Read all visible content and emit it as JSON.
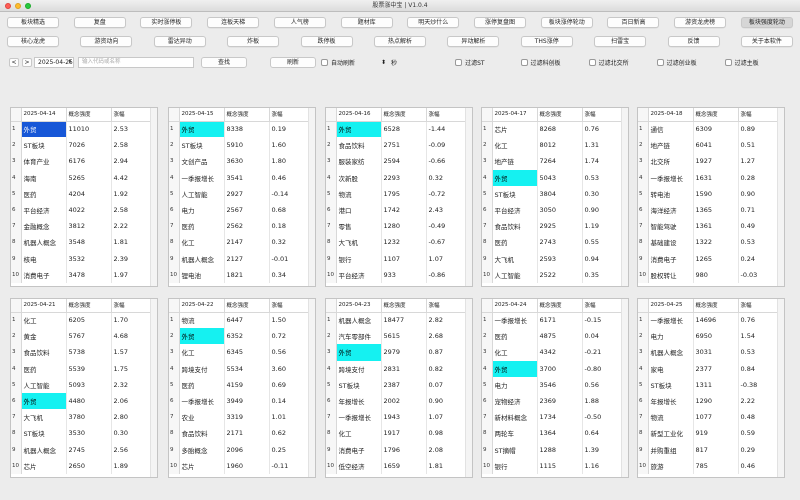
{
  "window": {
    "title": "股票涨中宝 | V1.0.4"
  },
  "toolbar_row1": [
    "板块精选",
    "复盘",
    "实时涨停板",
    "连板天梯",
    "人气榜",
    "题材库",
    "明天炒什么",
    "涨停复盘图",
    "板块涨停轮动",
    "百日新高",
    "游资龙虎榜",
    "板块强度轮动"
  ],
  "toolbar_row2": [
    "核心龙虎",
    "游资动向",
    "雷达异动",
    "炸板",
    "跌停板",
    "热点解析",
    "异动解析",
    "THS涨停",
    "扫雷宝",
    "反馈",
    "关于本软件"
  ],
  "controls": {
    "prev": "<",
    "next": ">",
    "date": "2025-04-25",
    "search_placeholder": "输入代码或名称",
    "find_label": "查找",
    "refresh_label": "刷新",
    "auto_refresh": "自动刷新",
    "seconds": "秒",
    "filter_st": "过滤ST",
    "filter_kcb": "过滤科创板",
    "filter_bjs": "过滤北交所",
    "filter_cyb": "过滤创业板",
    "filter_main": "过滤主板"
  },
  "colors": {
    "highlight_blue": "#1757d7",
    "highlight_cyan": "#15f1f1"
  },
  "table_headers": {
    "col2": "概念强度",
    "col3": "涨幅"
  },
  "panels": [
    {
      "date": "2025-04-14",
      "rows": [
        [
          "外贸",
          "11010",
          "2.53"
        ],
        [
          "ST板块",
          "7026",
          "2.58"
        ],
        [
          "体育产业",
          "6176",
          "2.94"
        ],
        [
          "海南",
          "5265",
          "4.42"
        ],
        [
          "医药",
          "4204",
          "1.92"
        ],
        [
          "平台经济",
          "4022",
          "2.58"
        ],
        [
          "金融概念",
          "3812",
          "2.22"
        ],
        [
          "机器人概念",
          "3548",
          "1.81"
        ],
        [
          "核电",
          "3532",
          "2.39"
        ],
        [
          "消费电子",
          "3478",
          "1.97"
        ]
      ],
      "hl": 0,
      "hl_color": "blue"
    },
    {
      "date": "2025-04-15",
      "rows": [
        [
          "外贸",
          "8338",
          "0.19"
        ],
        [
          "ST板块",
          "5910",
          "1.60"
        ],
        [
          "文创产品",
          "3630",
          "1.80"
        ],
        [
          "一季报增长",
          "3541",
          "0.46"
        ],
        [
          "人工智能",
          "2927",
          "-0.14"
        ],
        [
          "电力",
          "2567",
          "0.68"
        ],
        [
          "医药",
          "2562",
          "0.18"
        ],
        [
          "化工",
          "2147",
          "0.32"
        ],
        [
          "机器人概念",
          "2127",
          "-0.01"
        ],
        [
          "锂电池",
          "1821",
          "0.34"
        ]
      ],
      "hl": 0,
      "hl_color": "cyan"
    },
    {
      "date": "2025-04-16",
      "rows": [
        [
          "外贸",
          "6528",
          "-1.44"
        ],
        [
          "食品饮料",
          "2751",
          "-0.09"
        ],
        [
          "服装家纺",
          "2594",
          "-0.66"
        ],
        [
          "次新股",
          "2293",
          "0.32"
        ],
        [
          "物流",
          "1795",
          "-0.72"
        ],
        [
          "港口",
          "1742",
          "2.43"
        ],
        [
          "零售",
          "1280",
          "-0.49"
        ],
        [
          "大飞机",
          "1232",
          "-0.67"
        ],
        [
          "银行",
          "1107",
          "1.07"
        ],
        [
          "平台经济",
          "933",
          "-0.86"
        ]
      ],
      "hl": 0,
      "hl_color": "cyan"
    },
    {
      "date": "2025-04-17",
      "rows": [
        [
          "芯片",
          "8268",
          "0.76"
        ],
        [
          "化工",
          "8012",
          "1.31"
        ],
        [
          "地产链",
          "7264",
          "1.74"
        ],
        [
          "外贸",
          "5043",
          "0.53"
        ],
        [
          "ST板块",
          "3804",
          "0.30"
        ],
        [
          "平台经济",
          "3050",
          "0.90"
        ],
        [
          "食品饮料",
          "2925",
          "1.19"
        ],
        [
          "医药",
          "2743",
          "0.55"
        ],
        [
          "大飞机",
          "2593",
          "0.94"
        ],
        [
          "人工智能",
          "2522",
          "0.35"
        ]
      ],
      "hl": 3,
      "hl_color": "cyan"
    },
    {
      "date": "2025-04-18",
      "rows": [
        [
          "通信",
          "6309",
          "0.89"
        ],
        [
          "地产链",
          "6041",
          "0.51"
        ],
        [
          "北交所",
          "1927",
          "1.27"
        ],
        [
          "一季报增长",
          "1631",
          "0.28"
        ],
        [
          "转电池",
          "1590",
          "0.90"
        ],
        [
          "海洋经济",
          "1365",
          "0.71"
        ],
        [
          "智能驾驶",
          "1361",
          "0.49"
        ],
        [
          "基础建设",
          "1322",
          "0.53"
        ],
        [
          "消费电子",
          "1265",
          "0.24"
        ],
        [
          "股权转让",
          "980",
          "-0.03"
        ]
      ],
      "hl": -1,
      "hl_color": "none"
    },
    {
      "date": "2025-04-21",
      "rows": [
        [
          "化工",
          "6205",
          "1.70"
        ],
        [
          "黄金",
          "5767",
          "4.68"
        ],
        [
          "食品饮料",
          "5738",
          "1.57"
        ],
        [
          "医药",
          "5539",
          "1.75"
        ],
        [
          "人工智能",
          "5093",
          "2.32"
        ],
        [
          "外贸",
          "4480",
          "2.06"
        ],
        [
          "大飞机",
          "3780",
          "2.80"
        ],
        [
          "ST板块",
          "3530",
          "0.30"
        ],
        [
          "机器人概念",
          "2745",
          "2.56"
        ],
        [
          "芯片",
          "2650",
          "1.89"
        ]
      ],
      "hl": 5,
      "hl_color": "cyan"
    },
    {
      "date": "2025-04-22",
      "rows": [
        [
          "物流",
          "6447",
          "1.50"
        ],
        [
          "外贸",
          "6352",
          "0.72"
        ],
        [
          "化工",
          "6345",
          "0.56"
        ],
        [
          "跨境支付",
          "5534",
          "3.60"
        ],
        [
          "医药",
          "4159",
          "0.69"
        ],
        [
          "一季报增长",
          "3949",
          "0.14"
        ],
        [
          "农业",
          "3319",
          "1.01"
        ],
        [
          "食品饮料",
          "2171",
          "0.62"
        ],
        [
          "多胎概念",
          "2096",
          "0.25"
        ],
        [
          "芯片",
          "1960",
          "-0.11"
        ]
      ],
      "hl": 1,
      "hl_color": "cyan"
    },
    {
      "date": "2025-04-23",
      "rows": [
        [
          "机器人概念",
          "18477",
          "2.82"
        ],
        [
          "汽车零部件",
          "5615",
          "2.68"
        ],
        [
          "外贸",
          "2979",
          "0.87"
        ],
        [
          "跨境支付",
          "2831",
          "0.82"
        ],
        [
          "ST板块",
          "2387",
          "0.07"
        ],
        [
          "年报增长",
          "2002",
          "0.90"
        ],
        [
          "一季报增长",
          "1943",
          "1.07"
        ],
        [
          "化工",
          "1917",
          "0.98"
        ],
        [
          "消费电子",
          "1796",
          "2.08"
        ],
        [
          "低空经济",
          "1659",
          "1.81"
        ]
      ],
      "hl": 2,
      "hl_color": "cyan"
    },
    {
      "date": "2025-04-24",
      "rows": [
        [
          "一季报增长",
          "6171",
          "-0.15"
        ],
        [
          "医药",
          "4875",
          "0.04"
        ],
        [
          "化工",
          "4342",
          "-0.21"
        ],
        [
          "外贸",
          "3700",
          "-0.80"
        ],
        [
          "电力",
          "3546",
          "0.56"
        ],
        [
          "宠物经济",
          "2369",
          "1.88"
        ],
        [
          "新材料概念",
          "1734",
          "-0.50"
        ],
        [
          "两轮车",
          "1364",
          "0.64"
        ],
        [
          "ST摘帽",
          "1288",
          "1.39"
        ],
        [
          "银行",
          "1115",
          "1.16"
        ]
      ],
      "hl": 3,
      "hl_color": "cyan"
    },
    {
      "date": "2025-04-25",
      "rows": [
        [
          "一季报增长",
          "14696",
          "0.76"
        ],
        [
          "电力",
          "6950",
          "1.54"
        ],
        [
          "机器人概念",
          "3031",
          "0.53"
        ],
        [
          "家电",
          "2377",
          "0.84"
        ],
        [
          "ST板块",
          "1311",
          "-0.38"
        ],
        [
          "年报增长",
          "1290",
          "2.22"
        ],
        [
          "物流",
          "1077",
          "0.48"
        ],
        [
          "新型工业化",
          "919",
          "0.59"
        ],
        [
          "并购重组",
          "817",
          "0.29"
        ],
        [
          "旅游",
          "785",
          "0.46"
        ]
      ],
      "hl": -1,
      "hl_color": "none"
    }
  ]
}
